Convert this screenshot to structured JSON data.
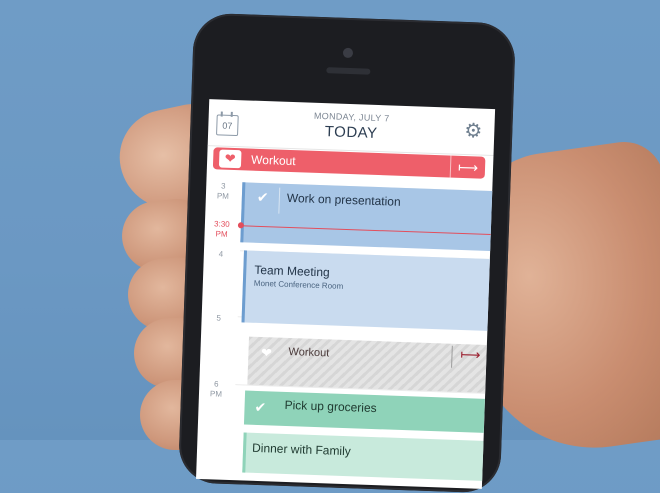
{
  "header": {
    "date": "MONDAY, JULY 7",
    "title": "TODAY",
    "calendar_day": "07"
  },
  "allday_event": {
    "label": "Workout"
  },
  "timeline": {
    "hours": [
      {
        "hour": "3",
        "suffix": "PM"
      },
      {
        "hour": "4",
        "suffix": ""
      },
      {
        "hour": "5",
        "suffix": ""
      },
      {
        "hour": "6",
        "suffix": "PM"
      }
    ],
    "now": {
      "hour": "3:30",
      "suffix": "PM"
    }
  },
  "events": {
    "presentation": {
      "title": "Work on presentation"
    },
    "meeting": {
      "title": "Team Meeting",
      "location": "Monet  Conference Room"
    },
    "workout": {
      "title": "Workout"
    },
    "groceries": {
      "title": "Pick up groceries"
    },
    "dinner": {
      "title": "Dinner with Family"
    }
  },
  "colors": {
    "accent_red": "#ee5f6a",
    "event_blue": "#a8c6e6",
    "event_green": "#8fd3b9"
  },
  "icons": {
    "calendar": "calendar-icon",
    "settings": "gear-icon",
    "heart": "heart-icon",
    "check": "check-icon",
    "arrow": "arrow-right-icon"
  }
}
